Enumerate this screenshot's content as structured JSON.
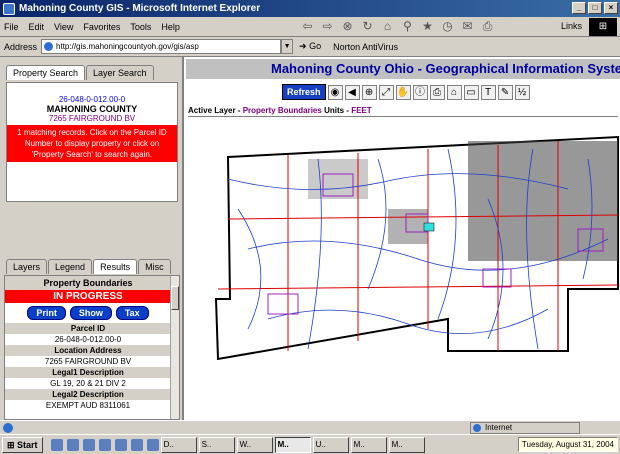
{
  "window": {
    "title": "Mahoning County GIS - Microsoft Internet Explorer"
  },
  "menu": {
    "items": [
      "File",
      "Edit",
      "View",
      "Favorites",
      "Tools",
      "Help"
    ],
    "links_label": "Links"
  },
  "address": {
    "label": "Address",
    "url": "http://gis.mahoningcountyoh.gov/gis/asp",
    "go_label": "Go",
    "norton_label": "Norton AntiVirus"
  },
  "left_panel": {
    "tabs_top": [
      "Property Search",
      "Layer Search"
    ],
    "parcel_id": "26-048-0-012.00-0",
    "county": "MAHONING COUNTY",
    "property_address": "7265 FAIRGROUND BV",
    "message": "1 matching records. Click on the Parcel ID Number to display property or click on 'Property Search' to search again.",
    "tabs_bottom": [
      "Layers",
      "Legend",
      "Results",
      "Misc"
    ],
    "results": {
      "title": "Property Boundaries",
      "status": "IN PROGRESS",
      "buttons": [
        "Print",
        "Show",
        "Tax"
      ],
      "fields": [
        {
          "label": "Parcel ID",
          "value": "26-048-0-012.00-0"
        },
        {
          "label": "Location Address",
          "value": "7265 FAIRGROUND BV"
        },
        {
          "label": "Legal1 Description",
          "value": "GL 19, 20 & 21 DIV 2"
        },
        {
          "label": "Legal2 Description",
          "value": "EXEMPT AUD 8311061"
        }
      ]
    }
  },
  "map_header": {
    "title": "Mahoning County Ohio - Geographical Information System",
    "refresh_label": "Refresh",
    "active_layer_label": "Active Layer -",
    "active_layer_value": "Property Boundaries",
    "units_label": "Units -",
    "units_value": "FEET"
  },
  "status": {
    "zone": "Internet"
  },
  "taskbar": {
    "start_label": "Start",
    "tasks": [
      "D..",
      "S..",
      "W..",
      "M..",
      "U..",
      "M..",
      "M.."
    ],
    "clock": "Tuesday, August 31, 2004"
  }
}
